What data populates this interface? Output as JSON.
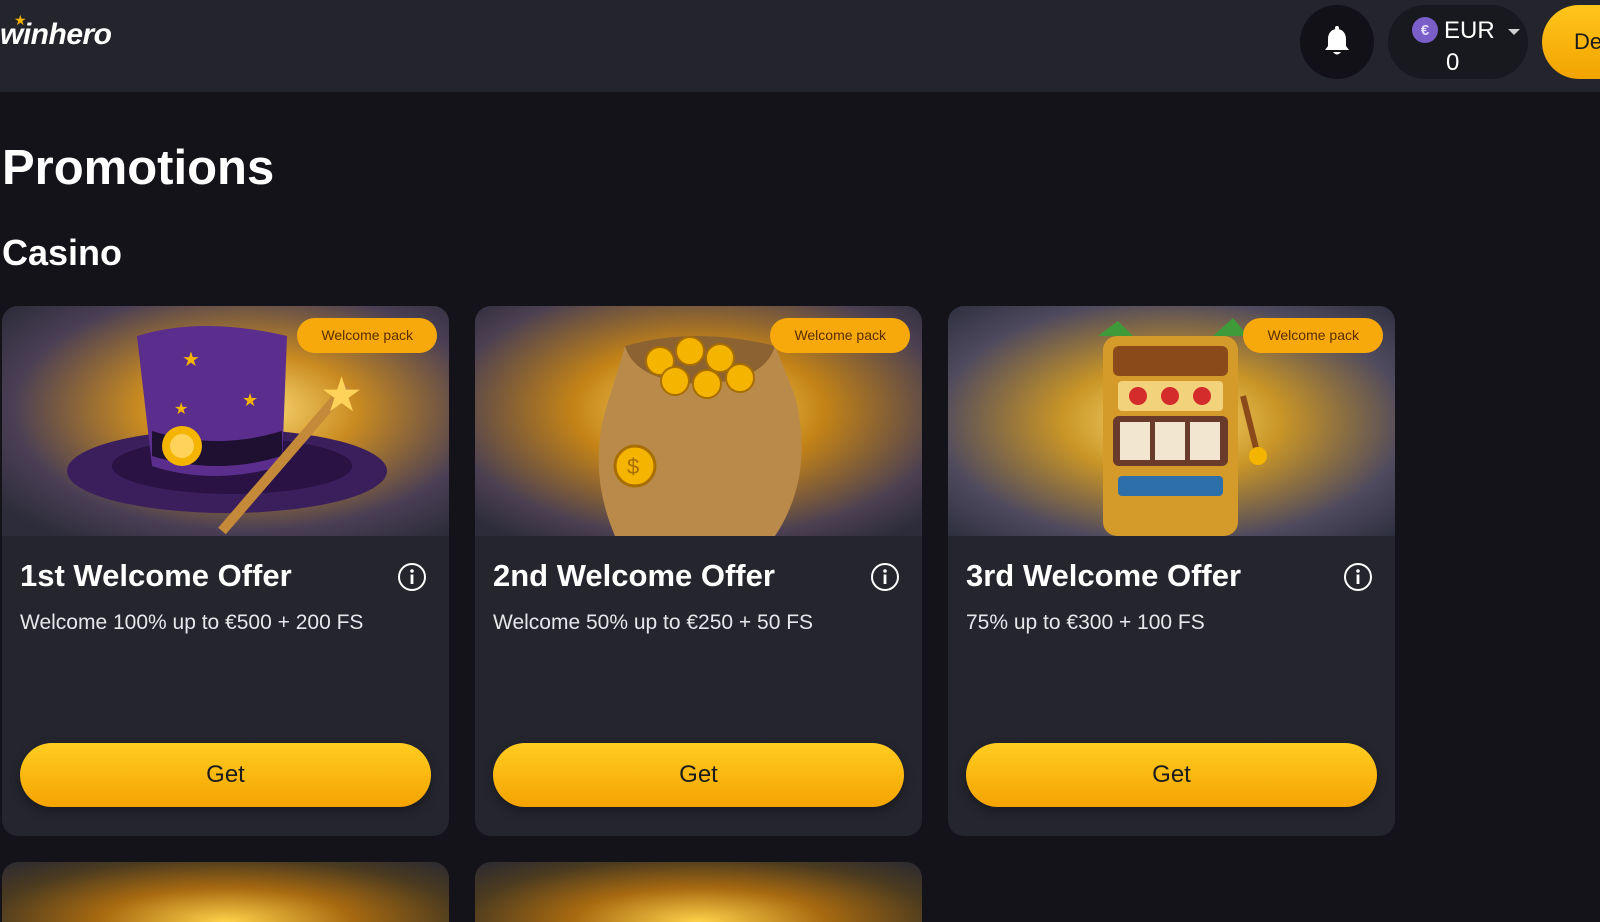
{
  "header": {
    "logo_text": "winhero",
    "balance": {
      "currency": "EUR",
      "amount": "0",
      "coin_symbol": "€"
    },
    "deposit_label": "De"
  },
  "page": {
    "title": "Promotions",
    "section": "Casino"
  },
  "cards": [
    {
      "badge": "Welcome pack",
      "title": "1st Welcome Offer",
      "description": "Welcome 100% up to €500 + 200 FS",
      "button": "Get",
      "image": "wizard-hat-image"
    },
    {
      "badge": "Welcome pack",
      "title": "2nd Welcome Offer",
      "description": "Welcome 50% up to €250 + 50 FS",
      "button": "Get",
      "image": "coin-bag-image"
    },
    {
      "badge": "Welcome pack",
      "title": "3rd Welcome Offer",
      "description": "75% up to €300 + 100 FS",
      "button": "Get",
      "image": "slot-machine-image"
    }
  ],
  "colors": {
    "background": "#131319",
    "header": "#24242d",
    "card": "#25252e",
    "accent": "#f7a90c",
    "button": "#ffc61a"
  }
}
